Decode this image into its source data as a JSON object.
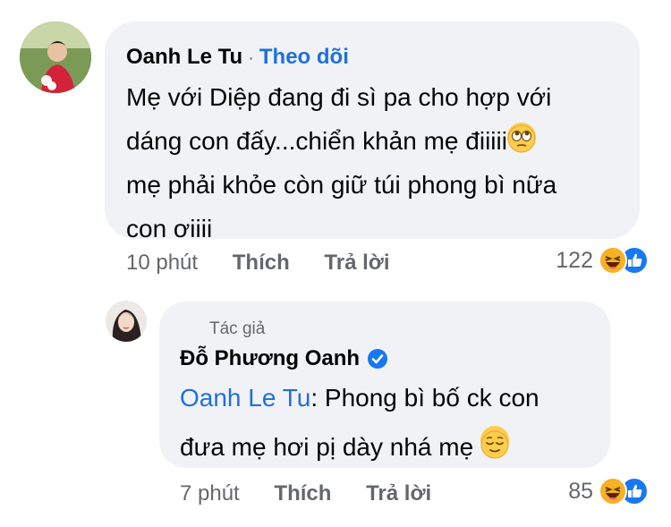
{
  "comment": {
    "author": "Oanh Le Tu",
    "separator": "·",
    "follow_label": "Theo dõi",
    "lines": [
      "Mẹ với Diệp đang đi sì pa cho hợp với",
      "dáng con đấy...chiển khản mẹ  điiiii",
      "mẹ phải khỏe còn giữ túi phong bì nữa",
      "con ơiiii"
    ],
    "emoji": "rolling-eyes-icon",
    "time": "10 phút",
    "like_label": "Thích",
    "reply_label": "Trả lời",
    "reaction_count": "122"
  },
  "reply": {
    "badge": "Tác giả",
    "author": "Đỗ Phương Oanh",
    "verified_icon": "verified-check-icon",
    "mention": "Oanh Le Tu",
    "text_line1": ": Phong bì bố ck con",
    "text_line2": "đưa mẹ hơi pị dày nhá mẹ",
    "emoji": "relieved-face-icon",
    "time": "7 phút",
    "like_label": "Thích",
    "reply_label": "Trả lời",
    "reaction_count": "85"
  },
  "colors": {
    "bubble": "#f0f2f5",
    "link_blue": "#216fdb",
    "meta_gray": "#65676b",
    "haha": "#f7b125",
    "like": "#1877f2"
  }
}
